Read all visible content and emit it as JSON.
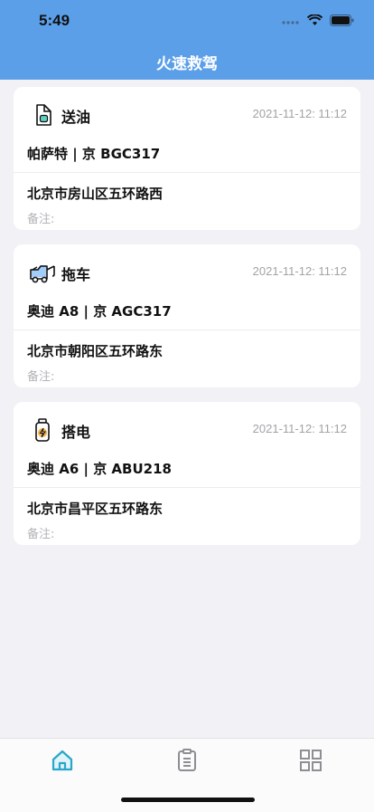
{
  "status_bar": {
    "time": "5:49"
  },
  "nav": {
    "title": "火速救驾"
  },
  "orders": [
    {
      "service": "送油",
      "icon": "fuel-can-icon",
      "time": "2021-11-12: 11:12",
      "vehicle": "帕萨特 | 京 BGC317",
      "address": "北京市房山区五环路西",
      "remark": "备注:"
    },
    {
      "service": "拖车",
      "icon": "tow-truck-icon",
      "time": "2021-11-12: 11:12",
      "vehicle": "奥迪 A8 | 京 AGC317",
      "address": "北京市朝阳区五环路东",
      "remark": "备注:"
    },
    {
      "service": "搭电",
      "icon": "battery-icon",
      "time": "2021-11-12: 11:12",
      "vehicle": "奥迪 A6 | 京 ABU218",
      "address": "北京市昌平区五环路东",
      "remark": "备注:"
    }
  ],
  "tabbar": {
    "tabs": [
      {
        "icon": "home-icon",
        "active": true
      },
      {
        "icon": "clipboard-icon",
        "active": false
      },
      {
        "icon": "grid-icon",
        "active": false
      }
    ],
    "active_color": "#2aa6c9",
    "inactive_color": "#8e8e93"
  },
  "colors": {
    "header": "#5b9fe8",
    "background": "#f1f1f6"
  }
}
